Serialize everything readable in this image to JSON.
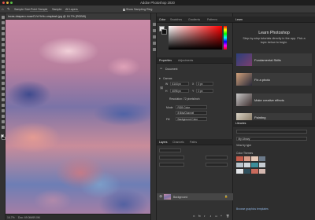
{
  "app": {
    "title": "Adobe Photoshop 2020"
  },
  "options_bar": {
    "sample_size_label": "Sample Size:",
    "sample_size_value": "Point Sample",
    "sample_label": "Sample:",
    "sample_value": "All Layers",
    "show_ring_label": "Show Sampling Ring"
  },
  "document": {
    "tab_title": "lucas-dasparo-nuaeCVcYhHo-unsplash.jpg @ 16.7% (RGB/8)",
    "zoom": "16.7%",
    "doc_size": "Doc: 69.0M/69.0M"
  },
  "color_panel": {
    "tabs": [
      "Color",
      "Swatches",
      "Gradients",
      "Patterns"
    ]
  },
  "properties_panel": {
    "tabs": [
      "Properties",
      "Adjustments"
    ],
    "document_label": "Document",
    "canvas_section": "Canvas",
    "w_label": "W",
    "w_value": "6144 px",
    "h_label": "H",
    "h_value": "4096 px",
    "x_label": "X",
    "x_value": "0 px",
    "y_label": "Y",
    "y_value": "0 px",
    "resolution": "Resolution: 72 pixels/inch",
    "mode_label": "Mode",
    "mode_value": "RGB Color",
    "depth_value": "8 Bits/Channel",
    "fill_label": "Fill",
    "fill_value": "Background Color"
  },
  "layers_panel": {
    "tabs": [
      "Layers",
      "Channels",
      "Paths"
    ],
    "background_layer": "Background"
  },
  "learn_panel": {
    "tab": "Learn",
    "heading": "Learn Photoshop",
    "description": "Step-by-step tutorials directly in the app. Pick a topic below to begin.",
    "cards": [
      "Fundamental Skills",
      "Fix a photo",
      "Make creative effects",
      "Painting"
    ]
  },
  "libraries_panel": {
    "tab": "Libraries",
    "library_name": "My Library",
    "view_by": "View by type",
    "colors_section": "Color Themes",
    "footer": "Browse graphics templates",
    "color_swatches": [
      "#c45a4a",
      "#d89a86",
      "#e6c9b8",
      "#6c7a8a",
      "#b8c4cc",
      "#cfd8dc",
      "#3c8e9a",
      "#c7cdd3",
      "#e2e5e8",
      "#2f4f5c",
      "#c96a5c",
      "#d4b8b0"
    ]
  }
}
